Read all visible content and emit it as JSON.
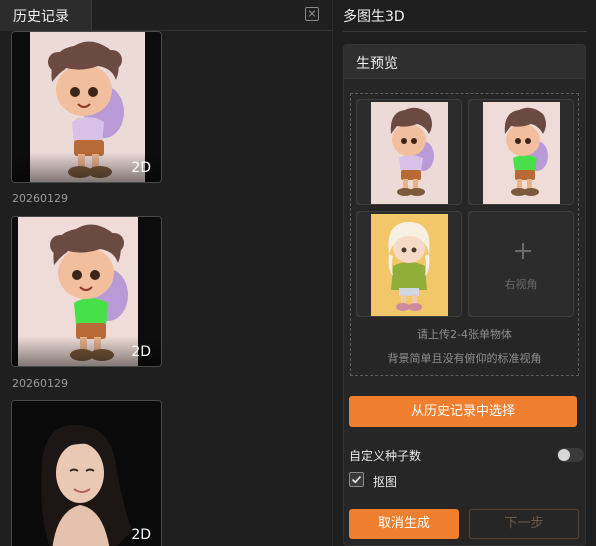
{
  "history_panel": {
    "tab_label": "历史记录",
    "items": [
      {
        "badge": "2D",
        "date": "20260129"
      },
      {
        "badge": "2D",
        "date": "20260129"
      },
      {
        "badge": "2D"
      }
    ]
  },
  "main": {
    "title": "多图生3D",
    "section_title": "生预览",
    "slots": [
      {
        "label": ""
      },
      {
        "label": ""
      },
      {
        "label": ""
      },
      {
        "label": "右视角"
      }
    ],
    "hint_line1": "请上传2-4张单物体",
    "hint_line2": "背景简单且没有俯仰的标准视角",
    "choose_button": "从历史记录中选择",
    "seed_label": "自定义种子数",
    "seed_toggle_on": false,
    "matting_label": "抠图",
    "matting_checked": true,
    "cancel_button": "取消生成",
    "next_button": "下一步"
  },
  "colors": {
    "accent": "#ef7f2e",
    "panel": "#262626",
    "background": "#1e1e1e"
  }
}
